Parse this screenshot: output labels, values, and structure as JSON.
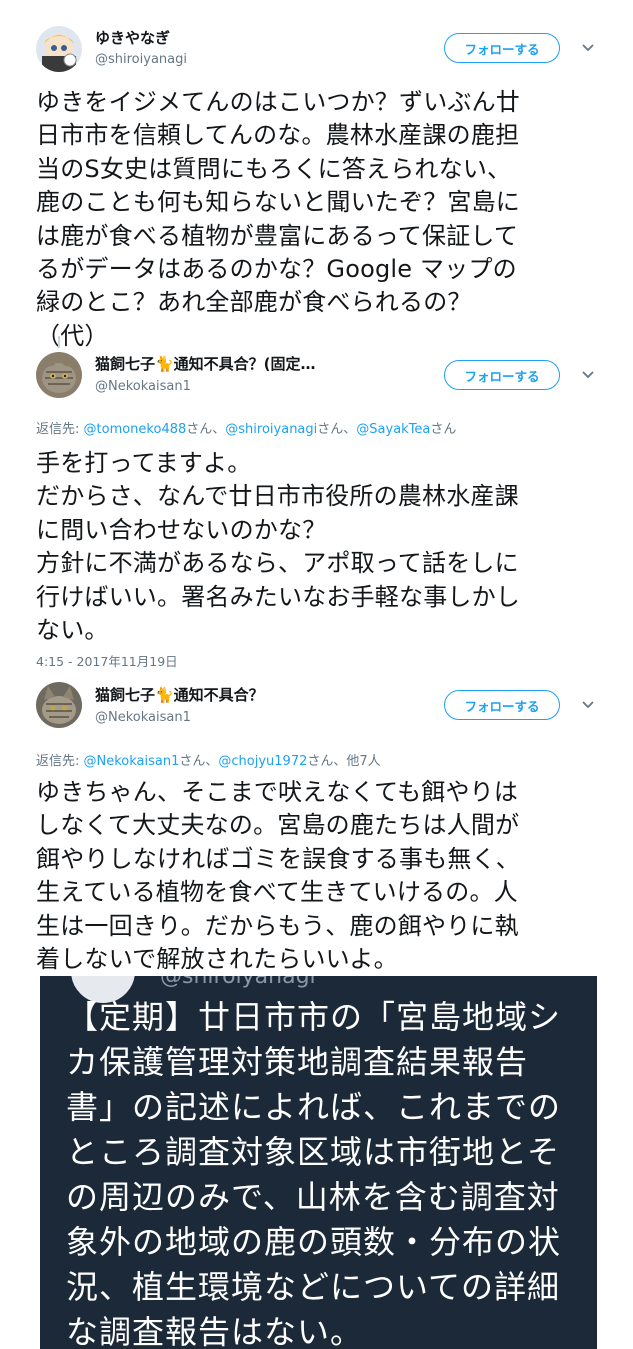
{
  "tweet1": {
    "name": "ゆきやなぎ",
    "handle": "@shiroiyanagi",
    "follow_label": "フォローする",
    "text": "ゆきをイジメてんのはこいつか？ずいぶん廿\n日市市を信頼してんのな。農林水産課の鹿担\n当のS女史は質問にもろくに答えられない、\n鹿のことも何も知らないと聞いたぞ？宮島に\nは鹿が食べる植物が豊富にあるって保証して\nるがデータはあるのかな？Google マップの\n緑のとこ？あれ全部鹿が食べられるの？\n（代）"
  },
  "tweet2": {
    "name": "猫飼七子🐈通知不具合？(固定…",
    "handle": "@Nekokaisan1",
    "follow_label": "フォローする",
    "reply_prefix": "返信先: ",
    "reply_user1": "@tomoneko488",
    "reply_sep1": "さん、",
    "reply_user2": "@shiroiyanagi",
    "reply_sep2": "さん、",
    "reply_user3": "@SayakTea",
    "reply_suffix": "さん",
    "text": "手を打ってますよ。\nだからさ、なんで廿日市市役所の農林水産課\nに問い合わせないのかな？\n方針に不満があるなら、アポ取って話をしに\n行けばいい。署名みたいなお手軽な事しかし\nない。",
    "timestamp": "4:15 - 2017年11月19日"
  },
  "tweet3": {
    "name": "猫飼七子🐈通知不具合？",
    "handle": "@Nekokaisan1",
    "follow_label": "フォローする",
    "reply_prefix": "返信先: ",
    "reply_user1": "@Nekokaisan1",
    "reply_sep1": "さん、",
    "reply_user2": "@chojyu1972",
    "reply_suffix": "さん、他7人",
    "text": "ゆきちゃん、そこまで吠えなくても餌やりは\nしなくて大丈夫なの。宮島の鹿たちは人間が\n餌やりしなければゴミを誤食する事も無く、\n生えている植物を食べて生きていけるの。人\n生は一回きり。だからもう、鹿の餌やりに執\n着しないで解放されたらいいよ。"
  },
  "embedded_card": {
    "handle_partial": "@shiroiyanagi",
    "text": "【定期】廿日市市の「宮島地域シ\nカ保護管理対策地調査結果報告\n書」の記述によれば、これまでの\nところ調査対象区域は市街地とそ\nの周辺のみで、山林を含む調査対\n象外の地域の鹿の頭数・分布の状\n況、植生環境などについての詳細\nな調査報告はない。"
  },
  "colors": {
    "accent": "#1da1f2",
    "secondary_text": "#657786",
    "card_background": "#1c2938"
  },
  "icons": [
    "chevron-down-icon",
    "avatar-cat-image",
    "avatar-anime-image"
  ]
}
